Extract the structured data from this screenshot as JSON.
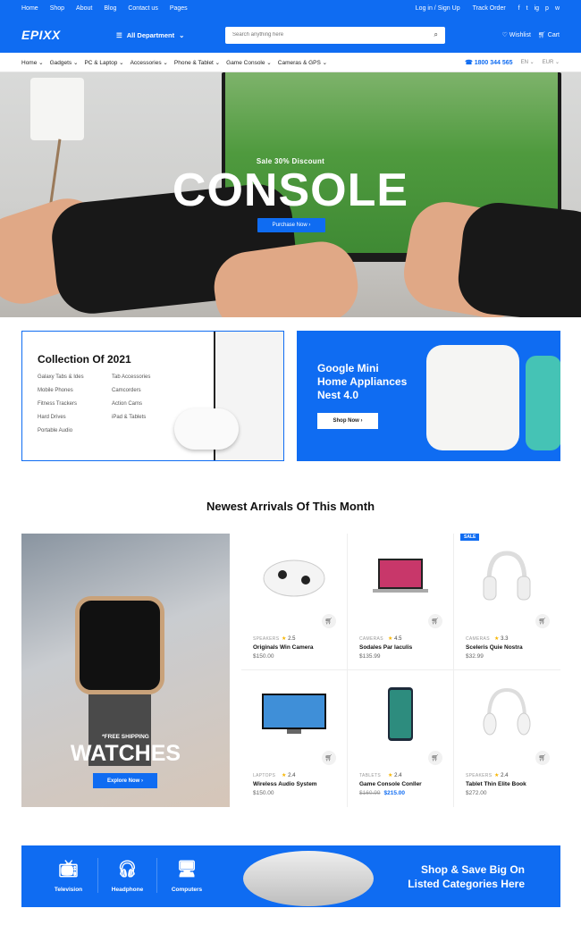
{
  "topbar": {
    "links": [
      "Home",
      "Shop",
      "About",
      "Blog",
      "Contact us",
      "Pages"
    ],
    "login": "Log in / Sign Up",
    "track": "Track Order",
    "social": [
      "f",
      "t",
      "ig",
      "p",
      "w"
    ]
  },
  "header": {
    "logo": "EPIXX",
    "department": "All Department",
    "search_placeholder": "Search anything here",
    "wishlist": "Wishlist",
    "cart": "Cart"
  },
  "nav": {
    "items": [
      "Home",
      "Gadgets",
      "PC & Laptop",
      "Accessories",
      "Phone & Tablet",
      "Game Console",
      "Cameras & GPS"
    ],
    "phone": "1800 344 565",
    "lang": "EN",
    "currency": "EUR"
  },
  "hero": {
    "sale": "Sale 30% Discount",
    "title": "CONSOLE",
    "button": "Purchase Now"
  },
  "collection": {
    "title": "Collection Of 2021",
    "col1": [
      "Galaxy Tabs & Ides",
      "Mobile Phones",
      "Fitness Trackers",
      "Hard Drives",
      "Portable Audio"
    ],
    "col2": [
      "Tab Accessories",
      "Camcorders",
      "Action Cams",
      "iPad & Tablets"
    ]
  },
  "promo": {
    "line1": "Google Mini",
    "line2": "Home Appliances",
    "line3": "Nest 4.0",
    "button": "Shop Now"
  },
  "section_title": "Newest Arrivals Of This Month",
  "watch": {
    "shipping": "*FREE SHIPPING",
    "title": "WATCHES",
    "button": "Explore Now"
  },
  "products": [
    {
      "category": "SPEAKERS",
      "rating": "2.5",
      "name": "Originals Win Camera",
      "price": "$150.00",
      "old": "",
      "badge": ""
    },
    {
      "category": "CAMERAS",
      "rating": "4.5",
      "name": "Sodales Par Iaculis",
      "price": "$135.99",
      "old": "",
      "badge": ""
    },
    {
      "category": "CAMERAS",
      "rating": "3.3",
      "name": "Sceleris Quie Nostra",
      "price": "$32.99",
      "old": "",
      "badge": "SALE"
    },
    {
      "category": "LAPTOPS",
      "rating": "2.4",
      "name": "Wireless Audio System",
      "price": "$150.00",
      "old": "",
      "badge": ""
    },
    {
      "category": "TABLETS",
      "rating": "2.4",
      "name": "Game Console Conller",
      "price": "$215.00",
      "old": "$160.99",
      "badge": ""
    },
    {
      "category": "SPEAKERS",
      "rating": "2.4",
      "name": "Tablet Thin Elite Book",
      "price": "$272.00",
      "old": "",
      "badge": ""
    }
  ],
  "bottom": {
    "categories": [
      "Television",
      "Headphone",
      "Computers"
    ],
    "msg1": "Shop & Save Big On",
    "msg2": "Listed Categories Here"
  },
  "colors": {
    "brand": "#0f6cf2"
  }
}
